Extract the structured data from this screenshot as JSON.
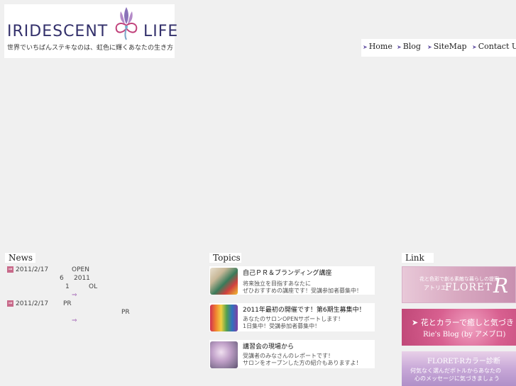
{
  "logo": {
    "word_left": "IRIDESCENT",
    "word_right": "LIFE",
    "tagline": "世界でいちばんステキなのは、虹色に輝くあなたの生き方"
  },
  "nav": {
    "items": [
      {
        "label": "Home"
      },
      {
        "label": "Blog"
      },
      {
        "label": "SiteMap"
      },
      {
        "label": "Contact Us"
      }
    ]
  },
  "news": {
    "heading": "News",
    "items": [
      {
        "date": "2011/2/17",
        "frag1": "OPEN",
        "frag2": "6",
        "frag3": "2011",
        "frag4": "1",
        "frag5": "OL",
        "more": "⇒"
      },
      {
        "date": "2011/2/17",
        "frag1": "PR",
        "frag2": "PR",
        "more": "⇒"
      }
    ]
  },
  "topics": {
    "heading": "Topics",
    "items": [
      {
        "title": "自己ＰＲ＆ブランディング講座",
        "line1": "将来独立を目指すあなたに",
        "line2": "ぜひおすすめの講座です！受講参加者募集中！"
      },
      {
        "title": "2011年最初の開催です！第6期生募集中！",
        "line1": "あなたのサロンOPENサポートします！",
        "line2": "1日集中！受講参加者募集中！"
      },
      {
        "title": "講習会の現場から",
        "line1": "受講者のみなさんのレポートです！",
        "line2": "サロンをオープンした方の紹介もありますよ！"
      }
    ]
  },
  "links": {
    "heading": "Link",
    "banners": [
      {
        "small": "花と色彩で創る素敵な暮らしの提案",
        "sub": "アトリエ",
        "name": "FLORET",
        "letter": "R"
      },
      {
        "title": "➤ 花とカラーで癒しと気づき",
        "sub": "Rie's Blog (by アメブロ)"
      },
      {
        "title": "FLORET-Rカラー診断",
        "line1": "何気なく選んだボトルからあなたの",
        "line2": "心のメッセージに気づきましょう"
      }
    ]
  }
}
